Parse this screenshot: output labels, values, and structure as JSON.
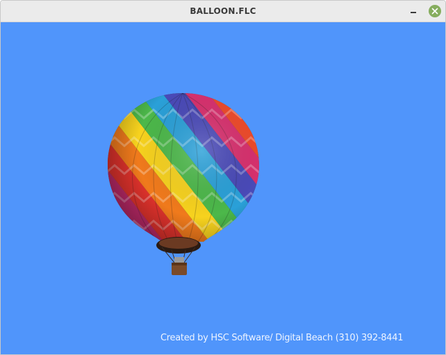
{
  "window": {
    "title": "BALLOON.FLC"
  },
  "controls": {
    "minimize_icon": "minimize-icon",
    "close_icon": "close-icon",
    "close_color": "#86ad5e"
  },
  "canvas": {
    "background": "#5095fb",
    "credit_text": "Created by HSC Software/ Digital Beach (310) 392-8441"
  }
}
